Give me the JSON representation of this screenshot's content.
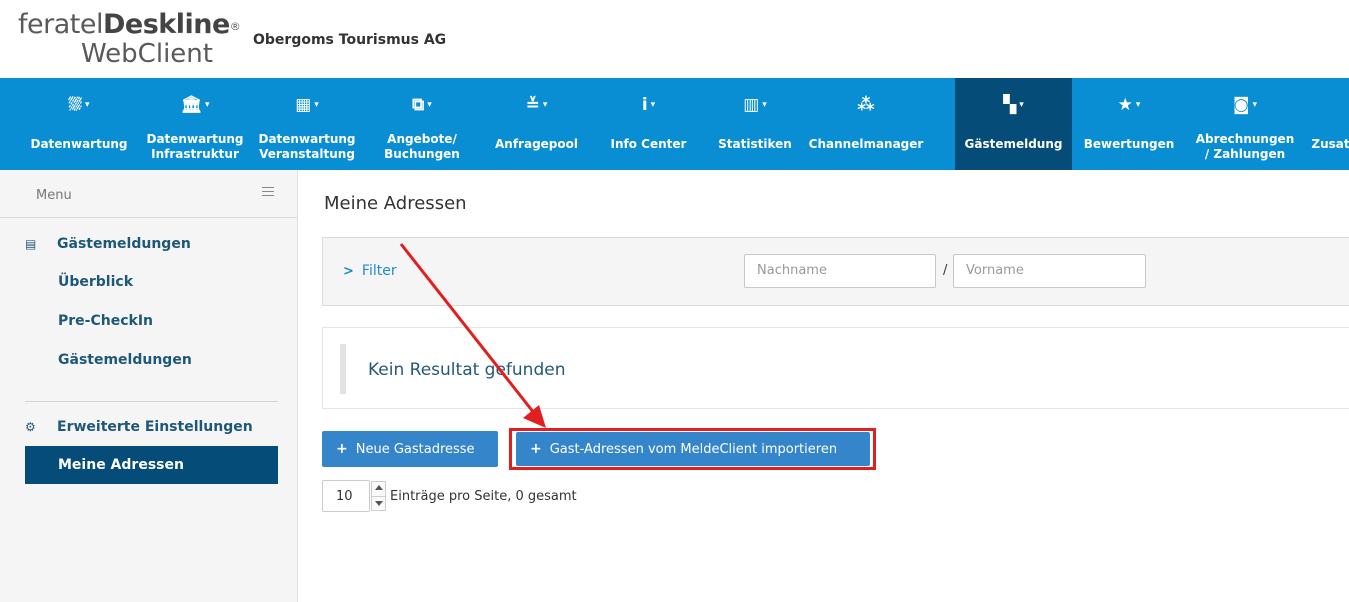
{
  "header": {
    "logo_brand_light": "feratel",
    "logo_brand_bold": "Deskline",
    "logo_reg": "®",
    "logo_product": "WebClient",
    "organization": "Obergoms Tourismus AG"
  },
  "nav": {
    "items": [
      {
        "label1": "Datenwartung",
        "label2": "",
        "icon": "bed-icon",
        "glyph": "⛆"
      },
      {
        "label1": "Datenwartung",
        "label2": "Infrastruktur",
        "icon": "institution-icon",
        "glyph": "🏛"
      },
      {
        "label1": "Datenwartung",
        "label2": "Veranstaltung",
        "icon": "calendar-icon",
        "glyph": "▦"
      },
      {
        "label1": "Angebote/",
        "label2": "Buchungen",
        "icon": "offers-icon",
        "glyph": "⧉"
      },
      {
        "label1": "Anfragepool",
        "label2": "",
        "icon": "inbox-stack-icon",
        "glyph": "≚"
      },
      {
        "label1": "Info Center",
        "label2": "",
        "icon": "info-icon",
        "glyph": "i"
      },
      {
        "label1": "Statistiken",
        "label2": "",
        "icon": "bar-chart-icon",
        "glyph": "▥"
      },
      {
        "label1": "Channelmanager",
        "label2": "",
        "icon": "sitemap-icon",
        "glyph": "⁂"
      },
      {
        "label1": "Gästemeldung",
        "label2": "",
        "icon": "document-icon",
        "glyph": "▚"
      },
      {
        "label1": "Bewertungen",
        "label2": "",
        "icon": "star-icon",
        "glyph": "★"
      },
      {
        "label1": "Abrechnungen",
        "label2": "/ Zahlungen",
        "icon": "money-icon",
        "glyph": "◙"
      },
      {
        "label1": "Zusatz",
        "label2": "",
        "icon": "more-icon",
        "glyph": ""
      }
    ],
    "active_index": 8
  },
  "sidebar": {
    "menu_label": "Menu",
    "section1": "Gästemeldungen",
    "links": [
      "Überblick",
      "Pre-CheckIn",
      "Gästemeldungen"
    ],
    "section2": "Erweiterte Einstellungen",
    "active_item": "Meine Adressen"
  },
  "main": {
    "title": "Meine Adressen",
    "filter_label": "Filter",
    "lastname_placeholder": "Nachname",
    "separator": "/",
    "firstname_placeholder": "Vorname",
    "no_result": "Kein Resultat gefunden",
    "btn_new": "Neue Gastadresse",
    "btn_import": "Gast-Adressen vom MeldeClient importieren",
    "page_size": "10",
    "pager_text": "Einträge pro Seite, 0 gesamt"
  },
  "colors": {
    "nav_bg": "#0a8ed3",
    "nav_active": "#054c78",
    "button": "#3585ca",
    "highlight": "#e21f1f",
    "link": "#1e5878"
  }
}
